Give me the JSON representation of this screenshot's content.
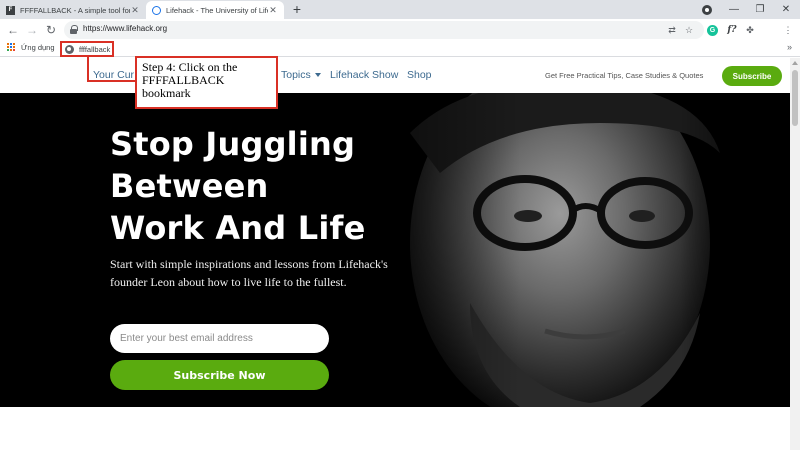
{
  "browser": {
    "tabs": [
      {
        "title": "FFFFALLBACK - A simple tool for",
        "close": "✕",
        "active": false
      },
      {
        "title": "Lifehack - The University of Life",
        "close": "✕",
        "active": true
      }
    ],
    "new_tab": "+",
    "window_controls": {
      "minimize": "—",
      "maximize": "❐",
      "close": "✕"
    },
    "nav": {
      "back": "←",
      "forward": "→",
      "reload": "↻"
    },
    "url": "https://www.lifehack.org",
    "toolbar_icons": [
      "translate-icon",
      "star-icon",
      "grammarly-icon",
      "f-extension-icon",
      "puzzle-icon",
      "menu-icon"
    ],
    "ext_labels": {
      "translate": "⇄",
      "star": "☆",
      "grammarly": "G",
      "f": "f?",
      "puzzle": "✤",
      "menu": "⋮"
    },
    "bookmarks": {
      "apps_label": "Ứng dụng",
      "items": [
        {
          "label": "ffffallback"
        }
      ],
      "more": "»"
    }
  },
  "site": {
    "nav": {
      "items": [
        {
          "label": "Your Cur"
        },
        {
          "label": "Topics"
        },
        {
          "label": "Lifehack Show"
        },
        {
          "label": "Shop"
        }
      ],
      "tagline": "Get Free Practical Tips, Case Studies & Quotes",
      "subscribe_label": "Subscribe"
    },
    "hero": {
      "title_lines": [
        "Stop Juggling",
        "Between",
        "Work And Life"
      ],
      "description": "Start with simple inspirations and lessons from Lifehack's founder Leon about how to live life to the fullest.",
      "email_placeholder": "Enter your best email address",
      "button_label": "Subscribe Now"
    }
  },
  "annotation": {
    "text": "Step 4: Click on the FFFFALLBACK bookmark"
  },
  "colors": {
    "accent_green": "#5aab0f",
    "nav_link": "#3d6a8f",
    "annotation_red": "#d93025"
  }
}
